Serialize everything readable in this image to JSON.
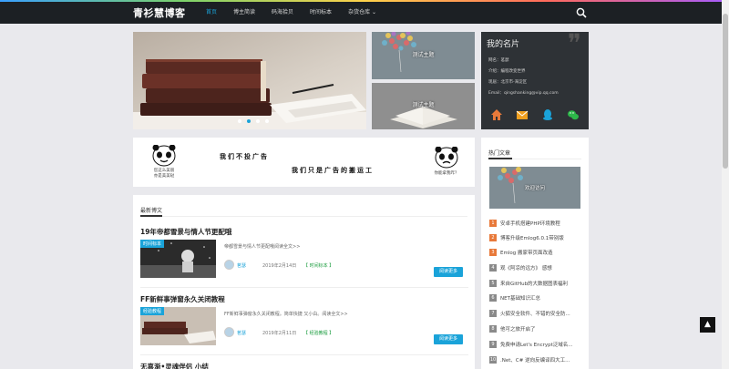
{
  "nav": {
    "logo": "青衫慧博客",
    "menu": [
      {
        "label": "首页",
        "active": true
      },
      {
        "label": "博主简读"
      },
      {
        "label": "码海拾贝"
      },
      {
        "label": "时间标本"
      },
      {
        "label": "杂货仓库 ⌄"
      }
    ],
    "search_icon": "search-icon"
  },
  "slider": {
    "active_dot": 1,
    "dot_count": 4
  },
  "thumbs": [
    {
      "caption": "测试主题"
    },
    {
      "caption": "测试主题"
    }
  ],
  "card": {
    "title": "我的名片",
    "lines": [
      "网名：茗瑟",
      "介绍：编程改变世界",
      "现居：北京市-海淀区",
      "Email：qingshanking@vip.qq.com"
    ],
    "icons": [
      "home-icon",
      "mail-icon",
      "qq-icon",
      "wechat-icon"
    ]
  },
  "ad": {
    "line1": "我们不投广告",
    "line2": "我们只是广告的搬运工",
    "left_caption": "您这么美丽\n亦是美美哒",
    "right_caption": "你能拿我咋？"
  },
  "posts": {
    "heading": "最新博文",
    "items": [
      {
        "title": "19年帝都雪景与情人节更配哦",
        "tag": "时间标本",
        "excerpt": "帝都雪景与情人节更配哦阅读全文>>",
        "author": "茗瑟",
        "date": "2019年2月14日",
        "category": "【 时间标本 】",
        "more": "阅读更多"
      },
      {
        "title": "FF新鲜事弹窗永久关闭教程",
        "tag": "经验教程",
        "excerpt": "FF新鲜事弹窗永久关闭教程。简单快捷 又小白。阅读全文>>",
        "author": "茗瑟",
        "date": "2019年2月11日",
        "category": "【 经验教程 】",
        "more": "阅读更多"
      },
      {
        "title": "无喜渐•灵魂伴侣 小结"
      }
    ]
  },
  "hot": {
    "heading": "热门文章",
    "image_caption": "欢迎访问",
    "items": [
      {
        "n": "1",
        "text": "安卓手机搭建PHP环境教程",
        "color": "#e8793a"
      },
      {
        "n": "2",
        "text": "博客升级Emlog6.0.1带别版",
        "color": "#e8793a"
      },
      {
        "n": "3",
        "text": "Emlog 搬家带页面改造",
        "color": "#e8793a"
      },
      {
        "n": "4",
        "text": "观《阿凉的远方》 感想",
        "color": "#8a8a8a"
      },
      {
        "n": "5",
        "text": "来自GitHub的大数据图表福利",
        "color": "#8a8a8a"
      },
      {
        "n": "6",
        "text": "NET基础知识汇总",
        "color": "#8a8a8a"
      },
      {
        "n": "7",
        "text": "火狐安全软件、不错的安全防...",
        "color": "#8a8a8a"
      },
      {
        "n": "8",
        "text": "他可之旅开启了",
        "color": "#8a8a8a"
      },
      {
        "n": "9",
        "text": "免费申请Let's Encrypt泛域名...",
        "color": "#8a8a8a"
      },
      {
        "n": "10",
        "text": ".Net、C# 逆向反编译四大工...",
        "color": "#8a8a8a"
      }
    ]
  },
  "totop": "▲"
}
